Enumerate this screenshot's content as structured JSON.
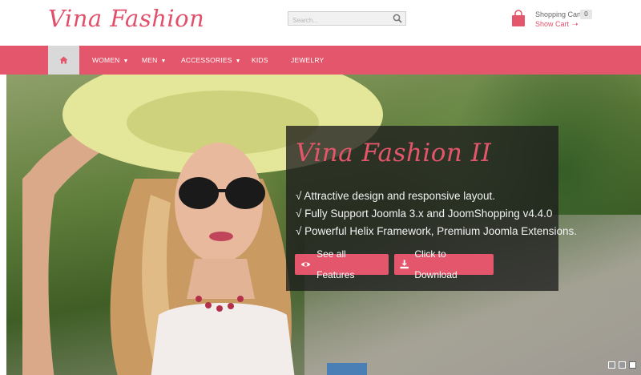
{
  "header": {
    "logo": "Vina Fashion",
    "search": {
      "placeholder": "Search..."
    },
    "cart": {
      "title": "Shopping Cart",
      "count": "0",
      "show_cart": "Show Cart"
    }
  },
  "nav": {
    "home_icon": "home-icon",
    "items": [
      {
        "label": "WOMEN",
        "has_dropdown": true
      },
      {
        "label": "MEN",
        "has_dropdown": true
      },
      {
        "label": "ACCESSORIES",
        "has_dropdown": true
      },
      {
        "label": "KIDS",
        "has_dropdown": false
      },
      {
        "label": "JEWELRY",
        "has_dropdown": false
      }
    ]
  },
  "hero": {
    "title": "Vina Fashion II",
    "features": [
      "√ Attractive design and responsive layout.",
      "√ Fully Support Joomla 3.x and JoomShopping v4.4.0",
      "√ Powerful Helix Framework, Premium Joomla Extensions."
    ],
    "buttons": {
      "features": {
        "label": "See all Features",
        "icon": "eye-icon"
      },
      "download": {
        "label": "Click to Download",
        "icon": "download-icon"
      }
    },
    "slides_total": 3,
    "active_slide": 3
  },
  "colors": {
    "accent": "#e4566b",
    "nav_home_bg": "#d9d9d9",
    "caption_bg": "#1e1e1e"
  }
}
